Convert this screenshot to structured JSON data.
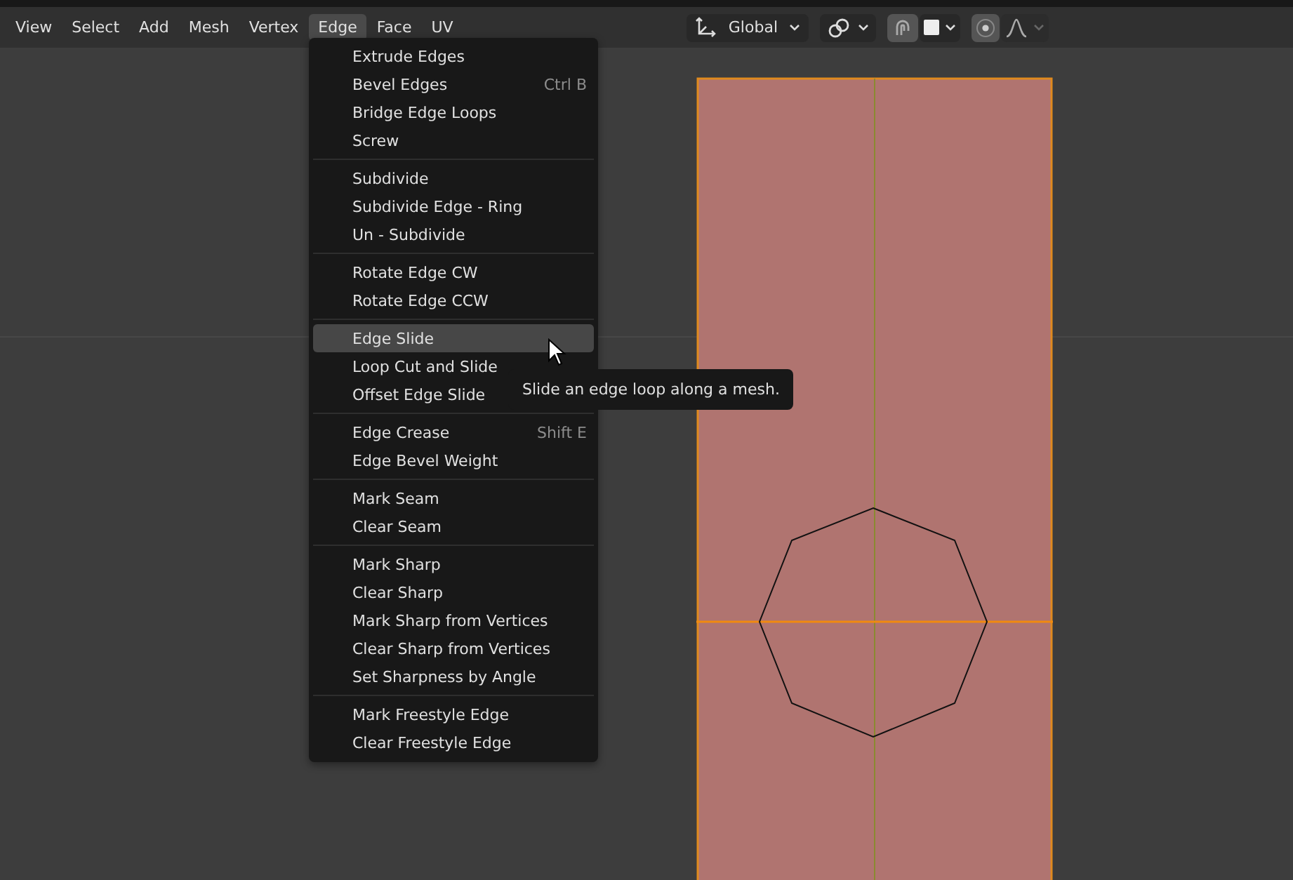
{
  "menubar": [
    {
      "label": "View",
      "selected": false
    },
    {
      "label": "Select",
      "selected": false
    },
    {
      "label": "Add",
      "selected": false
    },
    {
      "label": "Mesh",
      "selected": false
    },
    {
      "label": "Vertex",
      "selected": false
    },
    {
      "label": "Edge",
      "selected": true
    },
    {
      "label": "Face",
      "selected": false
    },
    {
      "label": "UV",
      "selected": false
    }
  ],
  "toolbar": {
    "orientation": "Global",
    "snap": {
      "on": true
    },
    "proportional_editing": {
      "on": true
    }
  },
  "menu": {
    "sections": [
      {
        "items": [
          {
            "label": "Extrude Edges",
            "selected": false
          },
          {
            "label": "Bevel Edges",
            "shortcut": "Ctrl B",
            "selected": false
          },
          {
            "label": "Bridge Edge Loops",
            "selected": false
          },
          {
            "label": "Screw",
            "selected": false
          }
        ]
      },
      {
        "items": [
          {
            "label": "Subdivide",
            "selected": false
          },
          {
            "label": "Subdivide Edge - Ring",
            "selected": false
          },
          {
            "label": "Un - Subdivide",
            "selected": false
          }
        ]
      },
      {
        "items": [
          {
            "label": "Rotate Edge CW",
            "selected": false
          },
          {
            "label": "Rotate Edge CCW",
            "selected": false
          }
        ]
      },
      {
        "items": [
          {
            "label": "Edge Slide",
            "selected": true
          },
          {
            "label": "Loop Cut and Slide",
            "selected": false
          },
          {
            "label": "Offset Edge Slide",
            "selected": false
          }
        ]
      },
      {
        "items": [
          {
            "label": "Edge Crease",
            "shortcut": "Shift E",
            "selected": false
          },
          {
            "label": "Edge Bevel Weight",
            "selected": false
          }
        ]
      },
      {
        "items": [
          {
            "label": "Mark Seam",
            "selected": false
          },
          {
            "label": "Clear Seam",
            "selected": false
          }
        ]
      },
      {
        "items": [
          {
            "label": "Mark Sharp",
            "selected": false
          },
          {
            "label": "Clear Sharp",
            "selected": false
          },
          {
            "label": "Mark Sharp from Vertices",
            "selected": false
          },
          {
            "label": "Clear Sharp from Vertices",
            "selected": false
          },
          {
            "label": "Set Sharpness by Angle",
            "selected": false
          }
        ]
      },
      {
        "items": [
          {
            "label": "Mark Freestyle Edge",
            "selected": false
          },
          {
            "label": "Clear Freestyle Edge",
            "selected": false
          }
        ]
      }
    ]
  },
  "tooltip": {
    "text": "Slide an edge loop along a mesh."
  }
}
